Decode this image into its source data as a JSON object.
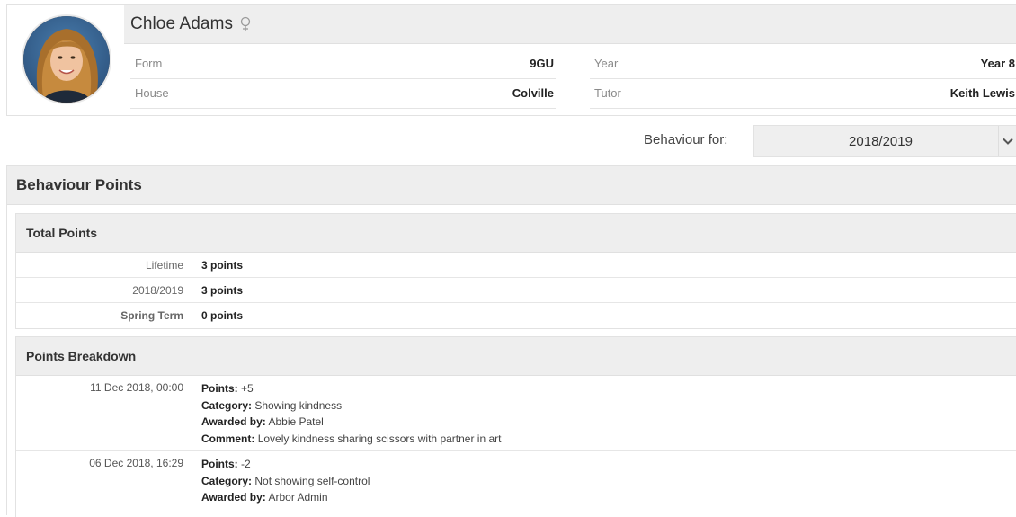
{
  "student": {
    "name": "Chloe Adams",
    "gender_icon": "female-icon",
    "avatar": "student-photo",
    "info": [
      {
        "label": "Form",
        "value": "9GU"
      },
      {
        "label": "Year",
        "value": "Year 8"
      },
      {
        "label": "House",
        "value": "Colville"
      },
      {
        "label": "Tutor",
        "value": "Keith Lewis"
      }
    ]
  },
  "behaviour_selector": {
    "label": "Behaviour for:",
    "selected": "2018/2019",
    "icon": "chevron-down-icon"
  },
  "behaviour_points": {
    "title": "Behaviour Points",
    "total_points": {
      "title": "Total Points",
      "rows": [
        {
          "label": "Lifetime",
          "value": "3 points"
        },
        {
          "label": "2018/2019",
          "value": "3 points"
        },
        {
          "label": "Spring Term",
          "value": "0 points"
        }
      ]
    },
    "breakdown": {
      "title": "Points Breakdown",
      "labels": {
        "points": "Points:",
        "category": "Category:",
        "awarded_by": "Awarded by:",
        "comment": "Comment:"
      },
      "entries": [
        {
          "date": "11 Dec 2018, 00:00",
          "points": "+5",
          "category": "Showing kindness",
          "awarded_by": "Abbie Patel",
          "comment": "Lovely kindness sharing scissors with partner in art"
        },
        {
          "date": "06 Dec 2018, 16:29",
          "points": "-2",
          "category": "Not showing self-control",
          "awarded_by": "Arbor Admin"
        }
      ]
    }
  },
  "colors": {
    "header_bg": "#eeeeee",
    "border": "#e2e2e2",
    "text": "#333333"
  }
}
